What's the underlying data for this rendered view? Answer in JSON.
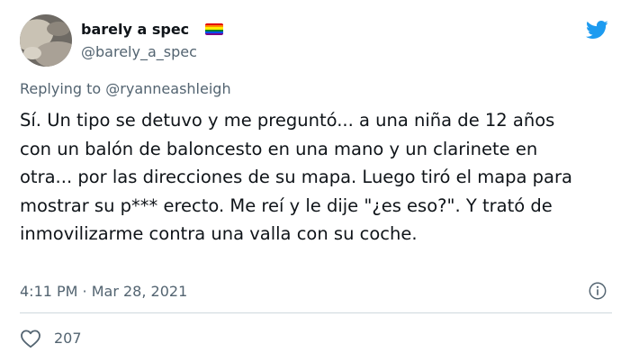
{
  "tweet": {
    "author": {
      "display_name": "barely a spec",
      "handle": "@barely_a_spec",
      "badge": "rainbow-flag-emoji"
    },
    "reply_context": {
      "prefix": "Replying to",
      "mention": "@ryanneashleigh"
    },
    "text": "Sí. Un tipo se detuvo y me preguntó... a una niña de 12 años\ncon un balón de baloncesto en una mano y un clarinete en\notra... por las direcciones de su mapa. Luego tiró el mapa para\nmostrar su p*** erecto. Me reí y le dije \"¿es eso?\". Y trató de\ninmovilizarme contra una valla con su coche.",
    "timestamp": "4:11 PM · Mar 28, 2021",
    "likes": "207"
  },
  "icons": {
    "brand": "twitter-bird-icon",
    "info": "info-icon",
    "like": "heart-icon"
  },
  "colors": {
    "brand_blue": "#1d9bf0",
    "text_primary": "#0f1419",
    "text_secondary": "#536471",
    "divider": "#cfd9de",
    "flag": [
      "#e40303",
      "#ff8c00",
      "#ffed00",
      "#008026",
      "#004dff",
      "#750787"
    ]
  }
}
